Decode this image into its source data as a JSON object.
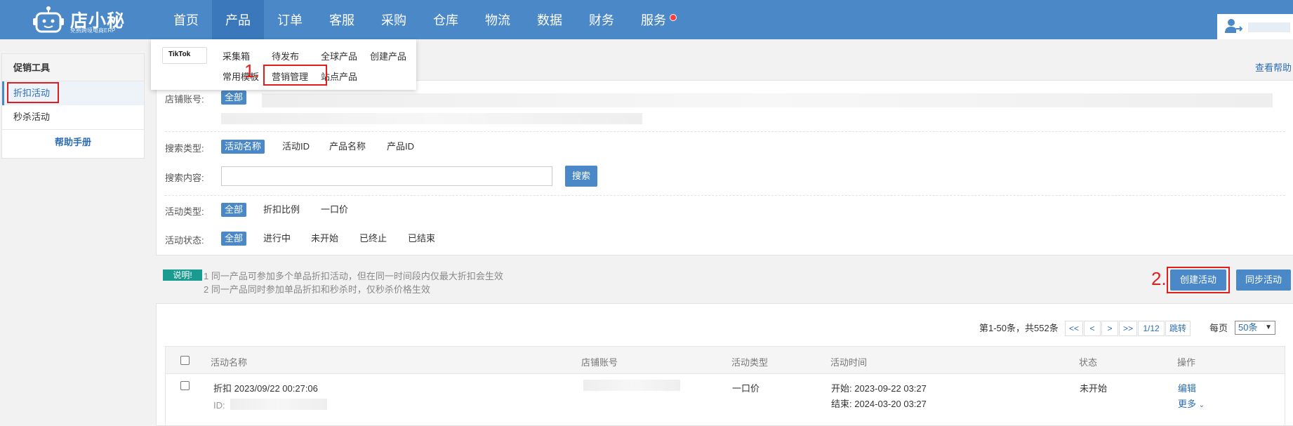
{
  "brand": {
    "name": "店小秘",
    "subtitle": "免费跨境电商ERP"
  },
  "nav": {
    "items": [
      {
        "label": "首页"
      },
      {
        "label": "产品"
      },
      {
        "label": "订单"
      },
      {
        "label": "客服"
      },
      {
        "label": "采购"
      },
      {
        "label": "仓库"
      },
      {
        "label": "物流"
      },
      {
        "label": "数据"
      },
      {
        "label": "财务"
      },
      {
        "label": "服务"
      }
    ],
    "active": "产品"
  },
  "dropdown": {
    "platform": "TikTok",
    "items": [
      "采集箱",
      "待发布",
      "全球产品",
      "创建产品",
      "常用模板",
      "营销管理",
      "站点产品"
    ]
  },
  "sidebar": {
    "title": "促销工具",
    "items": [
      {
        "label": "折扣活动"
      },
      {
        "label": "秒杀活动"
      }
    ],
    "help": "帮助手册"
  },
  "help_link": "查看帮助",
  "filters": {
    "store_label": "店铺账号:",
    "store_all": "全部",
    "search_type_label": "搜索类型:",
    "search_types": [
      "活动名称",
      "活动ID",
      "产品名称",
      "产品ID"
    ],
    "search_content_label": "搜索内容:",
    "search_value": "",
    "search_button": "搜索",
    "activity_type_label": "活动类型:",
    "activity_types": [
      "全部",
      "折扣比例",
      "一口价"
    ],
    "activity_status_label": "活动状态:",
    "activity_statuses": [
      "全部",
      "进行中",
      "未开始",
      "已终止",
      "已结束"
    ]
  },
  "notes": {
    "badge": "说明!",
    "lines": [
      "1 同一产品可参加多个单品折扣活动，但在同一时间段内仅最大折扣会生效",
      "2 同一产品同时参加单品折扣和秒杀时，仅秒杀价格生效"
    ]
  },
  "annotations": {
    "step1": "1.",
    "step2": "2."
  },
  "actions": {
    "create": "创建活动",
    "sync": "同步活动"
  },
  "pagination": {
    "summary": "第1-50条，共552条",
    "first": "<<",
    "prev": "<",
    "next": ">",
    "last": ">>",
    "page": "1/12",
    "jump": "跳转",
    "per_page_label": "每页",
    "per_page": "50条"
  },
  "table": {
    "headers": [
      "活动名称",
      "店铺账号",
      "活动类型",
      "活动时间",
      "状态",
      "操作"
    ],
    "rows": [
      {
        "name": "折扣 2023/09/22 00:27:06",
        "id_label": "ID:",
        "type": "一口价",
        "start": "开始: 2023-09-22 03:27",
        "end": "结束: 2024-03-20 03:27",
        "status": "未开始",
        "edit": "编辑",
        "more": "更多"
      }
    ]
  },
  "colors": {
    "brand_blue": "#4a88c8",
    "annotation_red": "#e01e1e",
    "note_teal": "#1a9b8f"
  }
}
